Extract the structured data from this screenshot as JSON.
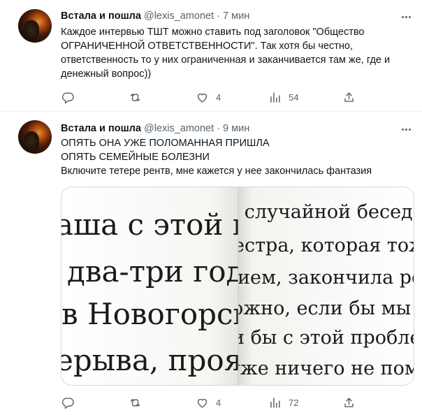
{
  "tweets": [
    {
      "author_name": "Встала и пошла",
      "handle": "@lexis_amonet",
      "separator": "·",
      "time": "7 мин",
      "text_lines": [
        "Каждое интервью ТШТ можно ставить под заголовок \"Общество",
        "ОГРАНИЧЕННОЙ ОТВЕТСТВЕННОСТИ\". Так хотя бы честно,",
        "ответственность то у них ограниченная и заканчивается там же, где и",
        "денежный вопрос))"
      ],
      "replies": "",
      "retweets": "",
      "likes": "4",
      "views": "54"
    },
    {
      "author_name": "Встала и пошла",
      "handle": "@lexis_amonet",
      "separator": "·",
      "time": "9 мин",
      "text_lines": [
        "ОПЯТЬ ОНА УЖЕ ПОЛОМАННАЯ ПРИШЛА",
        "ОПЯТЬ СЕМЕЙНЫЕ БОЛЕЗНИ",
        "Включите тетере рентв, мне кажется у нее закончилась фантазия"
      ],
      "media_left_lines": [
        "аша с этой пр",
        "два-три года",
        "в Новогорск",
        "ерыва, прояв"
      ],
      "media_right_lines": [
        "в случайной беседе",
        "естра, которая тоже",
        "ием, закончила ро",
        "ожно, если бы мы",
        "и бы с этой пробле",
        "уже ничего не поме"
      ],
      "replies": "",
      "retweets": "",
      "likes": "4",
      "views": "72"
    }
  ],
  "icons": {
    "reply": "reply-icon",
    "retweet": "retweet-icon",
    "like": "heart-icon",
    "views": "views-icon",
    "share": "share-icon",
    "more": "more-icon"
  }
}
